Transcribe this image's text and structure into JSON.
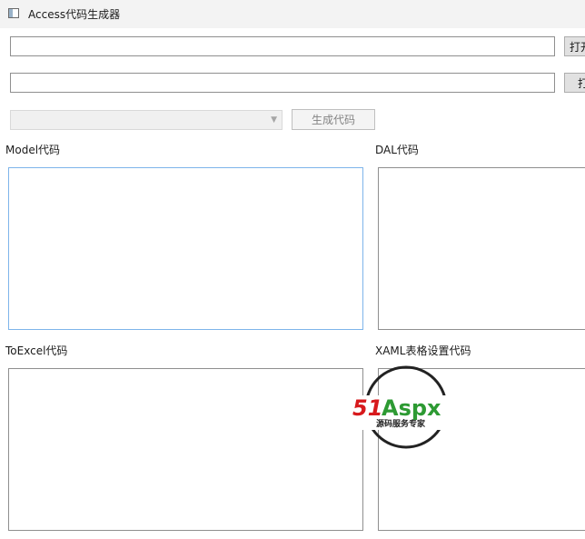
{
  "window": {
    "title": "Access代码生成器"
  },
  "row1": {
    "path_value": "",
    "open_button": "打开"
  },
  "row2": {
    "path_value": "",
    "open_button": "打开"
  },
  "table_select": {
    "value": ""
  },
  "generate_button": "生成代码",
  "sections": {
    "model": {
      "label": "Model代码",
      "code": ""
    },
    "dal": {
      "label": "DAL代码",
      "code": ""
    },
    "toexcel": {
      "label": "ToExcel代码",
      "code": ""
    },
    "xaml": {
      "label": "XAML表格设置代码",
      "code": ""
    }
  },
  "watermark": {
    "brand_51": "51",
    "brand_aspx": "Aspx",
    "tagline": "源码服务专家"
  },
  "colors": {
    "watermark_red": "#d7191c",
    "watermark_green": "#2d9a33",
    "focus_border": "#7eb4ea"
  }
}
